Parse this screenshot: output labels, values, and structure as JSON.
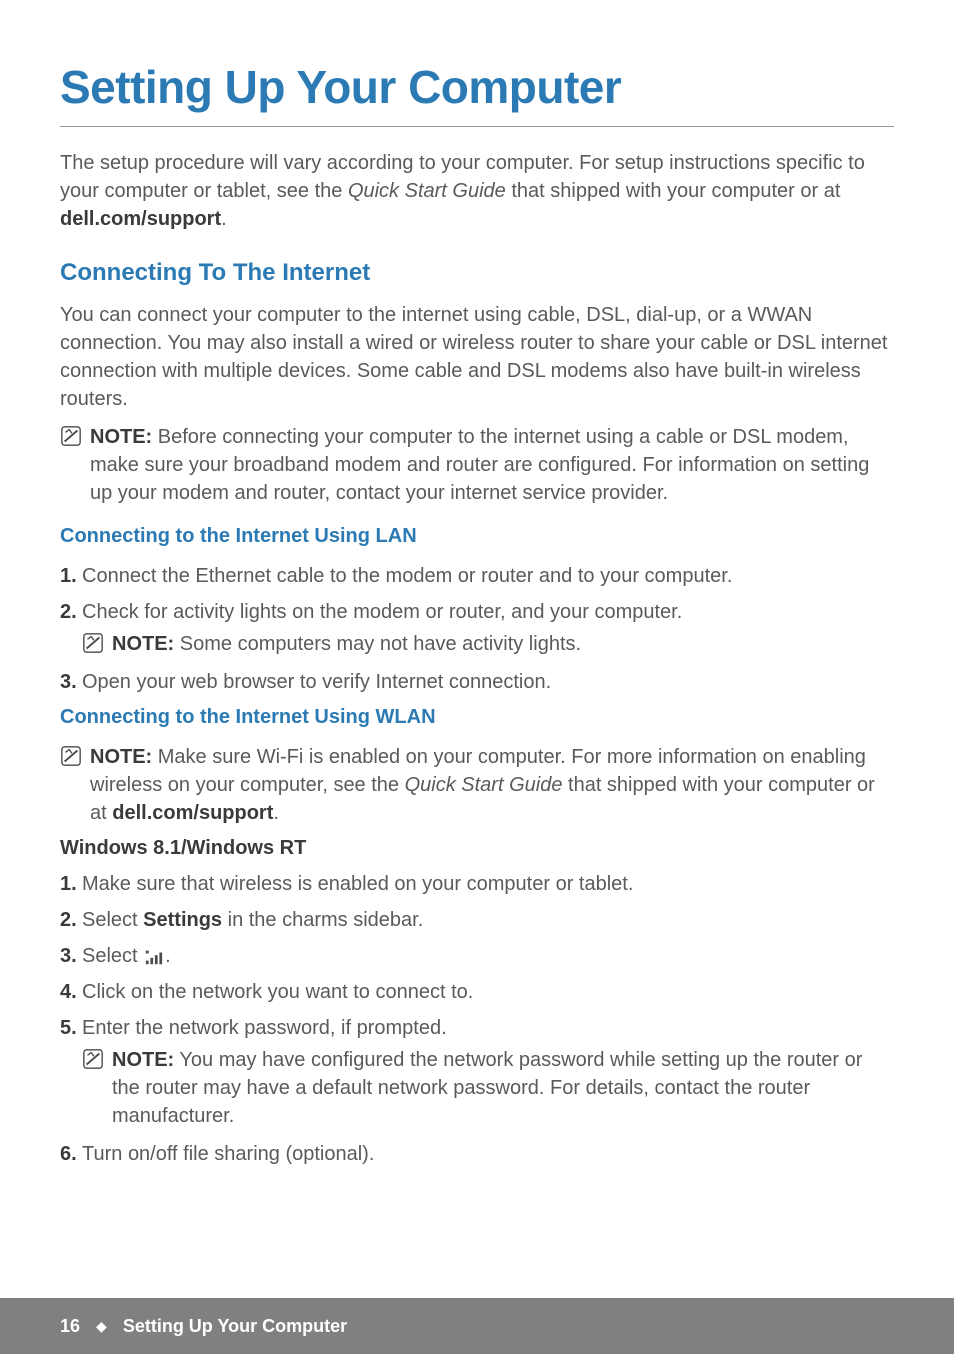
{
  "title": "Setting Up Your Computer",
  "intro": {
    "text_before": "The setup procedure will vary according to your computer. For setup instructions specific to your computer or tablet, see the ",
    "italic": "Quick Start Guide",
    "text_mid": " that shipped with your computer or at ",
    "bold": "dell.com/support",
    "text_after": "."
  },
  "section_connect": {
    "heading": "Connecting To The Internet",
    "body": "You can connect your computer to the internet using cable, DSL, dial-up, or a WWAN connection. You may also install a wired or wireless router to share your cable or DSL internet connection with multiple devices. Some cable and DSL modems also have built-in wireless routers.",
    "note_label": "NOTE:",
    "note_text": " Before connecting your computer to the internet using a cable or DSL modem, make sure your broadband modem and router are configured. For information on setting up your modem and router, contact your internet service provider."
  },
  "section_lan": {
    "heading": "Connecting to the Internet Using LAN",
    "items": {
      "n1": "1.",
      "t1": "Connect the Ethernet cable to the modem or router and to your computer.",
      "n2": "2.",
      "t2": "Check for activity lights on the modem or router, and your computer.",
      "note_label": "NOTE:",
      "note_text": " Some computers may not have activity lights.",
      "n3": "3.",
      "t3": "Open your web browser to verify Internet connection."
    }
  },
  "section_wlan": {
    "heading": "Connecting to the Internet Using WLAN",
    "note_label": "NOTE:",
    "note_before": " Make sure Wi-Fi is enabled on your computer. For more information on enabling wireless on your computer, see the ",
    "note_italic": "Quick Start Guide",
    "note_mid": " that shipped with your computer or at ",
    "note_bold": "dell.com/support",
    "note_after": "."
  },
  "section_windows": {
    "heading": "Windows 8.1/Windows RT",
    "items": {
      "n1": "1.",
      "t1": "Make sure that wireless is enabled on your computer or tablet.",
      "n2": "2.",
      "t2_before": "Select ",
      "t2_bold": "Settings",
      "t2_after": " in the charms sidebar.",
      "n3": "3.",
      "t3_before": "Select ",
      "t3_after": ".",
      "n4": "4.",
      "t4": "Click on the network you want to connect to.",
      "n5": "5.",
      "t5": "Enter the network password, if prompted.",
      "note_label": "NOTE:",
      "note_text": " You may have configured the network password while setting up the router or the router may have a default network password. For details, contact the router manufacturer.",
      "n6": "6.",
      "t6": "Turn on/off file sharing (optional)."
    }
  },
  "footer": {
    "page_num": "16",
    "diamond": "◆",
    "title": "Setting Up Your Computer"
  }
}
